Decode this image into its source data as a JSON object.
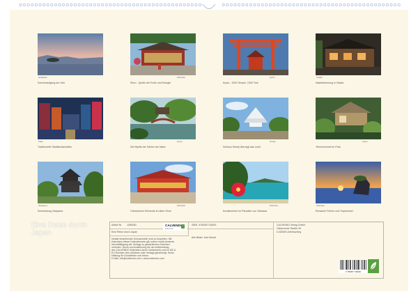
{
  "photos": [
    {
      "caption": "Sonnenaufgang am Ufer",
      "small": "Hokkaido"
    },
    {
      "caption": "Shuri - Quelle der Ruhe und Energie",
      "small": "Okinawa"
    },
    {
      "caption": "Kyoto - 1000 Tempel, 1000 Tore",
      "small": "Kyoto"
    },
    {
      "caption": "Nachtstimmung in Osaka",
      "small": "Osaka"
    },
    {
      "caption": "Traditionelle Stadtlandschaften",
      "small": "Tokio"
    },
    {
      "caption": "Die Mystik der Gärten der Natur",
      "small": "Kyoto"
    },
    {
      "caption": "Schloss Himeji überragt das Land",
      "small": "Himeji"
    },
    {
      "caption": "Teezeremonie im Park",
      "small": "Kyoto"
    },
    {
      "caption": "Schlossburg Okayama",
      "small": "Okayama"
    },
    {
      "caption": "Chinesische Elemente im alten Shuri",
      "small": "Okinawa"
    },
    {
      "caption": "Korallenmeer im Paradies von Okinawa",
      "small": "Okinawa"
    },
    {
      "caption": "Einsamer Felsen und Tropeninsel",
      "small": "Okinawa"
    }
  ],
  "calendar_title": "Eine Reise durch Japan",
  "info": {
    "article_label": "Artikel Nr.",
    "article_no": "1089263",
    "isbn_label": "ISBN",
    "isbn": "9783457743629",
    "product_title": "Eine Reise durch Japan",
    "photo_credit": "Alle Bilder: Karl Heindl",
    "publisher_lines": [
      "CALVENDO Verlag GmbH",
      "Ottobrunner Straße 39",
      "D-82008 Unterhaching"
    ],
    "legal_lines": [
      "Inhalte bestehender Schutzrechte sind zu beachten. Mit",
      "Kalendern dieser Kalenderserie gilt, sofern nichts Anderes",
      "Vervielfältigung der Verlags zu gewerblichen Zwecken",
      "verboten. Druck und Ausführung bei der Aufbereitung",
      "des CALVENDO Kalenders durch Verfasser/in und im DE &",
      "EU Rechten des Urhebers oder Verlags genehmigt. Keine",
      "Haftung für Druckfehler und Irrtum.",
      "E-Mail: info@calvendo.com • www.calvendo.com"
    ],
    "logo_text": "CALVENDO",
    "logo_sub": "Kalender"
  },
  "barcode_digits": "9 783457 743629",
  "colors": {
    "page": "#fbf6e6",
    "binding": "#aab8d8",
    "accent": "#5aa043"
  }
}
